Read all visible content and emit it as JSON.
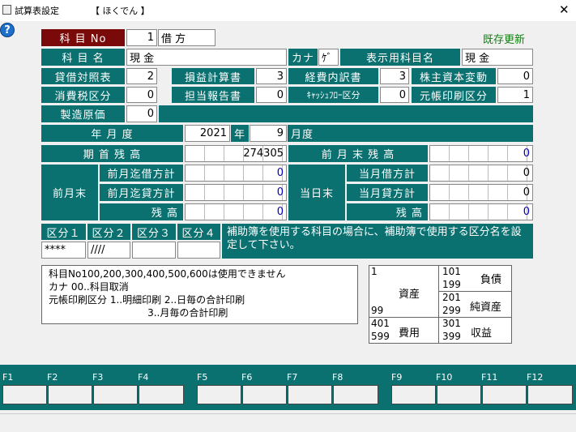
{
  "window": {
    "title": "試算表設定",
    "company": "【 ほくでん          】",
    "close_glyph": "✕"
  },
  "help_glyph": "?",
  "existing_update": "既存更新",
  "row1": {
    "kamoku_no_label": "科  目  No",
    "kamoku_no": "1",
    "debit_credit": "借  方"
  },
  "row2": {
    "kamoku_name_label": "科  目  名",
    "kamoku_name": "現        金",
    "kana_label": "カナ",
    "kana": "ｹﾞ",
    "display_name_label": "表示用科目名",
    "display_name": "現    金"
  },
  "row3": [
    {
      "label": "貸借対照表",
      "value": "2"
    },
    {
      "label": "損益計算書",
      "value": "3"
    },
    {
      "label": "経費内訳書",
      "value": "3"
    },
    {
      "label": "株主資本変動",
      "value": "0"
    }
  ],
  "row4": [
    {
      "label": "消費税区分",
      "value": "0"
    },
    {
      "label": "担当報告書",
      "value": "0"
    },
    {
      "label": "ｷｬｯｼｭﾌﾛｰ区分",
      "value": "0"
    },
    {
      "label": "元帳印刷区分",
      "value": "1"
    }
  ],
  "row5": {
    "label": "製造原価",
    "value": "0"
  },
  "year_month": {
    "label": "年  月  度",
    "year": "2021",
    "year_unit": "年",
    "month": "9",
    "month_unit": "月度"
  },
  "balance": {
    "opening_label": "期  首  残  高",
    "opening_value": "274305",
    "prev_end_label": "前  月  末  残  高",
    "prev_end_value": "0",
    "prev_month_label": "前月末",
    "prev_debit_label": "前月迄借方計",
    "prev_debit_value": "0",
    "prev_credit_label": "前月迄貸方計",
    "prev_credit_value": "0",
    "prev_balance_label": "残      高",
    "prev_balance_value": "0",
    "today_end_label": "当日末",
    "cur_debit_label": "当月借方計",
    "cur_debit_value": "0",
    "cur_credit_label": "当月貸方計",
    "cur_credit_value": "0",
    "cur_balance_label": "残      高",
    "cur_balance_value": "0"
  },
  "kubun": {
    "labels": [
      "区分１",
      "区分２",
      "区分３",
      "区分４"
    ],
    "values": [
      "****",
      "////",
      "",
      ""
    ],
    "notice": "補助簿を使用する科目の場合に、補助簿で使用する区分名を設定して下さい。"
  },
  "info_lines": [
    "科目No100,200,300,400,500,600は使用できません",
    "カナ  00..科目取消",
    "元帳印刷区分  1..明細印刷    2..日毎の合計印刷",
    "                                3..月毎の合計印刷"
  ],
  "accounts": {
    "asset_top": "1",
    "asset_bottom": "99",
    "asset_label": "資産",
    "liab_top": "101",
    "liab_bottom": "199",
    "liab_label": "負債",
    "netasset_top": "201",
    "netasset_bottom": "299",
    "netasset_label": "純資産",
    "expense_top": "401",
    "expense_bottom": "599",
    "expense_label": "費用",
    "revenue_top": "301",
    "revenue_bottom": "399",
    "revenue_label": "収益"
  },
  "fkeys": [
    "F1",
    "F2",
    "F3",
    "F4",
    "F5",
    "F6",
    "F7",
    "F8",
    "F9",
    "F10",
    "F11",
    "F12"
  ]
}
